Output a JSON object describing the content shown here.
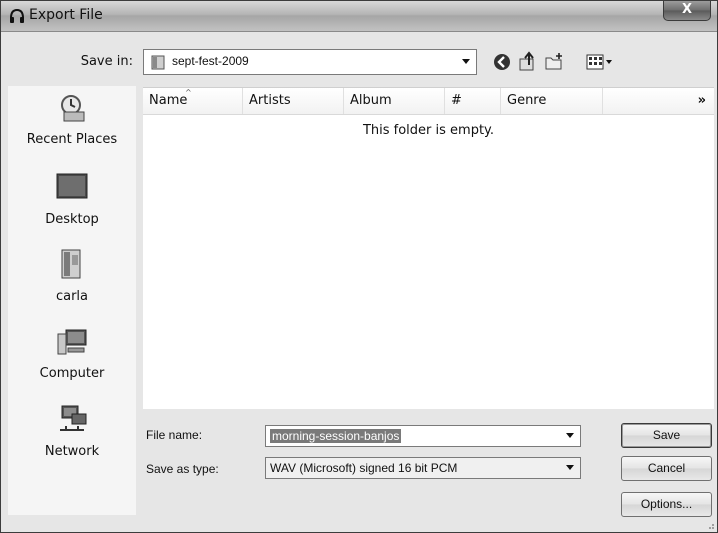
{
  "window": {
    "title": "Export File",
    "close_label": "X"
  },
  "save_in": {
    "label": "Save in:",
    "value": "sept-fest-2009"
  },
  "toolbar": {
    "icons": [
      "back-icon",
      "up-folder-icon",
      "new-folder-icon",
      "views-menu-icon"
    ]
  },
  "places": [
    {
      "label": "Recent Places",
      "icon": "recent-places-icon"
    },
    {
      "label": "Desktop",
      "icon": "desktop-icon"
    },
    {
      "label": "carla",
      "icon": "user-folder-icon"
    },
    {
      "label": "Computer",
      "icon": "computer-icon"
    },
    {
      "label": "Network",
      "icon": "network-icon"
    }
  ],
  "file_list": {
    "columns": [
      "Name",
      "Artists",
      "Album",
      "#",
      "Genre"
    ],
    "more_columns_glyph": "»",
    "empty_message": "This folder is empty."
  },
  "file_name": {
    "label": "File name:",
    "value": "morning-session-banjos"
  },
  "save_as_type": {
    "label": "Save as type:",
    "value": "WAV (Microsoft) signed 16 bit PCM"
  },
  "buttons": {
    "save": "Save",
    "cancel": "Cancel",
    "options": "Options..."
  }
}
